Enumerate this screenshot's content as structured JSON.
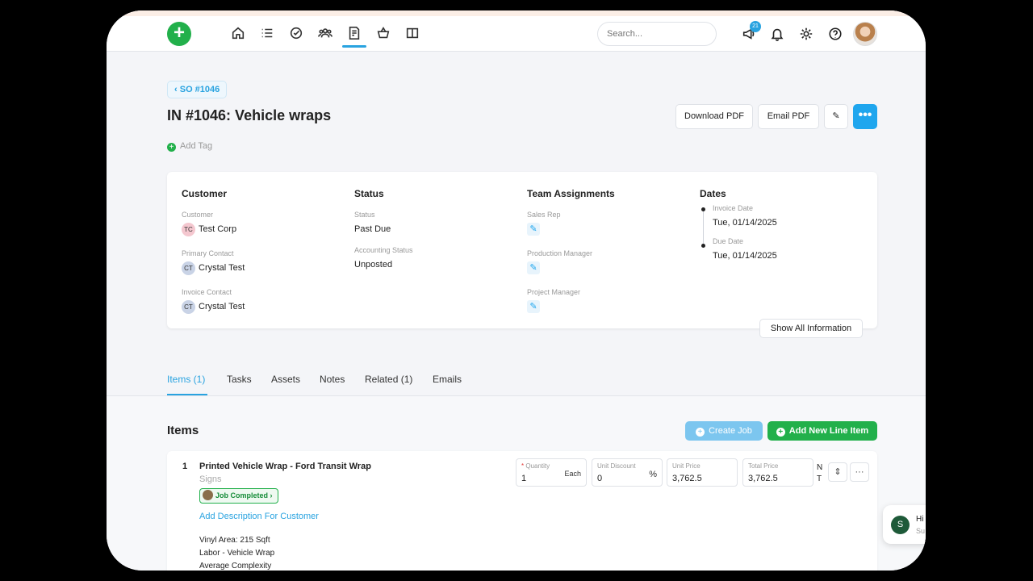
{
  "header": {
    "search_placeholder": "Search...",
    "notification_count": "21"
  },
  "breadcrumb": "SO #1046",
  "page_title": "IN #1046: Vehicle wraps",
  "actions": {
    "download_pdf": "Download PDF",
    "email_pdf": "Email PDF",
    "more": "•••"
  },
  "add_tag": "Add Tag",
  "info": {
    "customer": {
      "heading": "Customer",
      "customer_label": "Customer",
      "customer_initials": "TC",
      "customer_name": "Test Corp",
      "primary_contact_label": "Primary Contact",
      "primary_contact_initials": "CT",
      "primary_contact_name": "Crystal Test",
      "invoice_contact_label": "Invoice Contact",
      "invoice_contact_initials": "CT",
      "invoice_contact_name": "Crystal Test"
    },
    "status": {
      "heading": "Status",
      "status_label": "Status",
      "status_value": "Past Due",
      "accounting_label": "Accounting Status",
      "accounting_value": "Unposted"
    },
    "team": {
      "heading": "Team Assignments",
      "sales_rep_label": "Sales Rep",
      "production_manager_label": "Production Manager",
      "project_manager_label": "Project Manager"
    },
    "dates": {
      "heading": "Dates",
      "invoice_date_label": "Invoice Date",
      "invoice_date": "Tue, 01/14/2025",
      "due_date_label": "Due Date",
      "due_date": "Tue, 01/14/2025"
    },
    "show_all": "Show All Information"
  },
  "tabs": [
    "Items (1)",
    "Tasks",
    "Assets",
    "Notes",
    "Related (1)",
    "Emails"
  ],
  "items_section": {
    "heading": "Items",
    "create_job": "Create Job",
    "add_line_item": "Add New Line Item"
  },
  "line_item": {
    "number": "1",
    "name": "Printed Vehicle Wrap - Ford Transit Wrap",
    "category": "Signs",
    "job_status": "Job Completed",
    "add_description": "Add Description For Customer",
    "description_lines": [
      "Vinyl Area: 215 Sqft",
      "Labor - Vehicle Wrap",
      "Average Complexity"
    ],
    "quantity_label": "Quantity",
    "quantity": "1",
    "quantity_unit": "Each",
    "unit_discount_label": "Unit Discount",
    "unit_discount": "0",
    "unit_discount_unit": "%",
    "unit_price_label": "Unit Price",
    "unit_price": "3,762.5",
    "total_price_label": "Total Price",
    "total_price": "3,762.5",
    "nt_top": "N",
    "nt_bottom": "T"
  },
  "chat": {
    "avatar_letter": "S",
    "greeting": "Hi",
    "sub": "Su"
  },
  "colors": {
    "brand_green": "#22b04b",
    "accent_blue": "#29a3e0"
  }
}
